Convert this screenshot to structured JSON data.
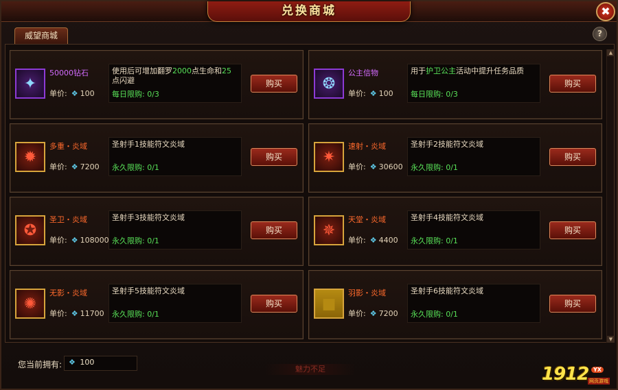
{
  "window": {
    "title": "兑换商城",
    "close_glyph": "✖",
    "help_glyph": "?"
  },
  "tabs": [
    {
      "label": "威望商城"
    }
  ],
  "items": [
    {
      "name": "50000钻石",
      "name_color": "purple",
      "icon": "diamond-pile-icon",
      "price_label": "单价:",
      "price": "100",
      "desc_parts": [
        "使用后可增加翻罗",
        "2000",
        "点生命和",
        "25",
        "点闪避"
      ],
      "limit": "每日限购: 0/3",
      "buy": "购买"
    },
    {
      "name": "公主信物",
      "name_color": "purple",
      "icon": "princess-token-icon",
      "price_label": "单价:",
      "price": "100",
      "desc_parts": [
        "用于",
        "护卫公主",
        "活动中提升任务品质"
      ],
      "limit": "每日限购: 0/3",
      "buy": "购买"
    },
    {
      "name": "多重・炎域",
      "name_color": "orange",
      "icon": "multishot-rune-icon",
      "price_label": "单价:",
      "price": "7200",
      "desc": "圣射手1技能符文炎域",
      "limit": "永久限购: 0/1",
      "buy": "购买"
    },
    {
      "name": "速射・炎域",
      "name_color": "orange",
      "icon": "rapidfire-rune-icon",
      "price_label": "单价:",
      "price": "30600",
      "desc": "圣射手2技能符文炎域",
      "limit": "永久限购: 0/1",
      "buy": "购买"
    },
    {
      "name": "圣卫・炎域",
      "name_color": "orange",
      "icon": "holyguard-rune-icon",
      "price_label": "单价:",
      "price": "108000",
      "desc": "圣射手3技能符文炎域",
      "limit": "永久限购: 0/1",
      "buy": "购买"
    },
    {
      "name": "天堂・炎域",
      "name_color": "orange",
      "icon": "heaven-rune-icon",
      "price_label": "单价:",
      "price": "4400",
      "desc": "圣射手4技能符文炎域",
      "limit": "永久限购: 0/1",
      "buy": "购买"
    },
    {
      "name": "无影・炎域",
      "name_color": "orange",
      "icon": "shadowless-rune-icon",
      "price_label": "单价:",
      "price": "11700",
      "desc": "圣射手5技能符文炎域",
      "limit": "永久限购: 0/1",
      "buy": "购买"
    },
    {
      "name": "羽影・炎域",
      "name_color": "orange",
      "icon": "featherShadow-rune-icon",
      "price_label": "单价:",
      "price": "7200",
      "desc": "圣射手6技能符文炎域",
      "limit": "永久限购: 0/1",
      "buy": "购买"
    }
  ],
  "footer": {
    "owned_label": "您当前拥有:",
    "owned_value": "100",
    "status": "魅力不足"
  },
  "logo": {
    "number": "1912",
    "badge": "YX",
    "sub": "网页游戏"
  },
  "colors": {
    "highlight_green": "#58e058",
    "name_purple": "#d36bff",
    "name_orange": "#ff6a2c",
    "gem_blue": "#5ec8e6"
  }
}
